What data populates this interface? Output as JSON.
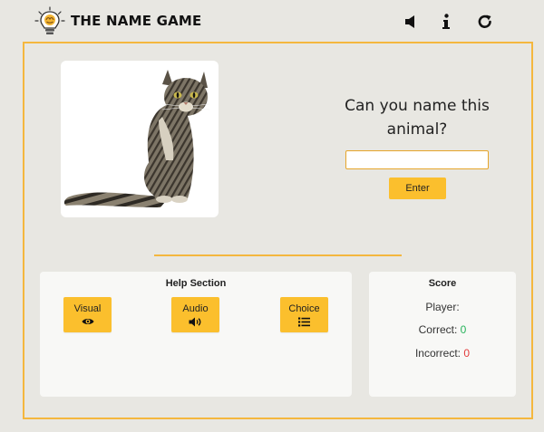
{
  "app": {
    "title": "THE NAME GAME"
  },
  "toolbar": {
    "sound_icon": "speaker-icon",
    "info_icon": "info-icon",
    "restart_icon": "restart-icon"
  },
  "quiz": {
    "image_subject": "tabby cat",
    "question": "Can you name this animal?",
    "answer_value": "",
    "enter_label": "Enter"
  },
  "help": {
    "title": "Help Section",
    "buttons": [
      {
        "label": "Visual",
        "icon": "eye-icon"
      },
      {
        "label": "Audio",
        "icon": "volume-icon"
      },
      {
        "label": "Choice",
        "icon": "list-icon"
      }
    ]
  },
  "score": {
    "title": "Score",
    "player_label": "Player:",
    "player_value": "",
    "correct_label": "Correct:",
    "correct_value": "0",
    "incorrect_label": "Incorrect:",
    "incorrect_value": "0"
  },
  "colors": {
    "accent": "#fbbf2d",
    "frame": "#f4b73e",
    "background": "#e8e7e2",
    "correct": "#27b35a",
    "incorrect": "#e23b3b"
  }
}
